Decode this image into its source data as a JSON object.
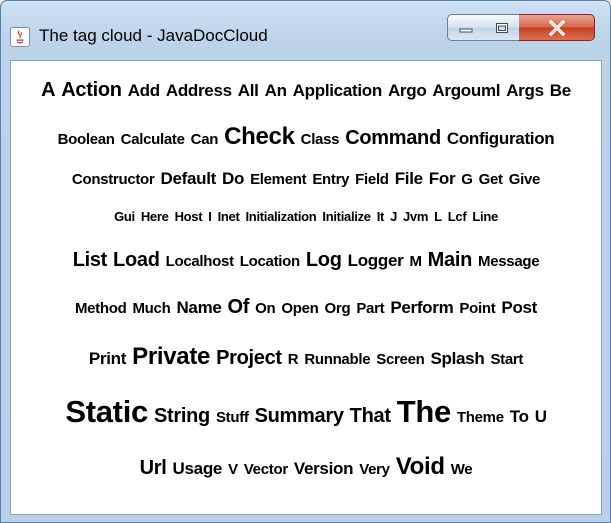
{
  "window": {
    "title": "The tag cloud - JavaDocCloud",
    "controls": {
      "minimize": "minimize",
      "maximize": "maximize",
      "close": "close"
    }
  },
  "tag_cloud": {
    "rows": [
      [
        {
          "text": "A",
          "size": 4
        },
        {
          "text": "Action",
          "size": 4
        },
        {
          "text": "Add",
          "size": 3
        },
        {
          "text": "Address",
          "size": 3
        },
        {
          "text": "All",
          "size": 3
        },
        {
          "text": "An",
          "size": 3
        },
        {
          "text": "Application",
          "size": 3
        },
        {
          "text": "Argo",
          "size": 3
        },
        {
          "text": "Argouml",
          "size": 3
        },
        {
          "text": "Args",
          "size": 3
        },
        {
          "text": "Be",
          "size": 3
        }
      ],
      [
        {
          "text": "Boolean",
          "size": 2
        },
        {
          "text": "Calculate",
          "size": 2
        },
        {
          "text": "Can",
          "size": 2
        },
        {
          "text": "Check",
          "size": 5
        },
        {
          "text": "Class",
          "size": 2
        },
        {
          "text": "Command",
          "size": 4
        },
        {
          "text": "Configuration",
          "size": 3
        }
      ],
      [
        {
          "text": "Constructor",
          "size": 2
        },
        {
          "text": "Default",
          "size": 3
        },
        {
          "text": "Do",
          "size": 3
        },
        {
          "text": "Element",
          "size": 2
        },
        {
          "text": "Entry",
          "size": 2
        },
        {
          "text": "Field",
          "size": 2
        },
        {
          "text": "File",
          "size": 3
        },
        {
          "text": "For",
          "size": 3
        },
        {
          "text": "G",
          "size": 2
        },
        {
          "text": "Get",
          "size": 2
        },
        {
          "text": "Give",
          "size": 2
        }
      ],
      [
        {
          "text": "Gui",
          "size": 1
        },
        {
          "text": "Here",
          "size": 1
        },
        {
          "text": "Host",
          "size": 1
        },
        {
          "text": "I",
          "size": 1
        },
        {
          "text": "Inet",
          "size": 1
        },
        {
          "text": "Initialization",
          "size": 1
        },
        {
          "text": "Initialize",
          "size": 1
        },
        {
          "text": "It",
          "size": 1
        },
        {
          "text": "J",
          "size": 1
        },
        {
          "text": "Jvm",
          "size": 1
        },
        {
          "text": "L",
          "size": 1
        },
        {
          "text": "Lcf",
          "size": 1
        },
        {
          "text": "Line",
          "size": 1
        }
      ],
      [
        {
          "text": "List",
          "size": 4
        },
        {
          "text": "Load",
          "size": 4
        },
        {
          "text": "Localhost",
          "size": 2
        },
        {
          "text": "Location",
          "size": 2
        },
        {
          "text": "Log",
          "size": 4
        },
        {
          "text": "Logger",
          "size": 3
        },
        {
          "text": "M",
          "size": 2
        },
        {
          "text": "Main",
          "size": 4
        },
        {
          "text": "Message",
          "size": 2
        }
      ],
      [
        {
          "text": "Method",
          "size": 2
        },
        {
          "text": "Much",
          "size": 2
        },
        {
          "text": "Name",
          "size": 3
        },
        {
          "text": "Of",
          "size": 4
        },
        {
          "text": "On",
          "size": 2
        },
        {
          "text": "Open",
          "size": 2
        },
        {
          "text": "Org",
          "size": 2
        },
        {
          "text": "Part",
          "size": 2
        },
        {
          "text": "Perform",
          "size": 3
        },
        {
          "text": "Point",
          "size": 2
        },
        {
          "text": "Post",
          "size": 3
        }
      ],
      [
        {
          "text": "Print",
          "size": 3
        },
        {
          "text": "Private",
          "size": 5
        },
        {
          "text": "Project",
          "size": 4
        },
        {
          "text": "R",
          "size": 2
        },
        {
          "text": "Runnable",
          "size": 2
        },
        {
          "text": "Screen",
          "size": 2
        },
        {
          "text": "Splash",
          "size": 3
        },
        {
          "text": "Start",
          "size": 2
        }
      ],
      [
        {
          "text": "Static",
          "size": 6
        },
        {
          "text": "String",
          "size": 4
        },
        {
          "text": "Stuff",
          "size": 2
        },
        {
          "text": "Summary",
          "size": 4
        },
        {
          "text": "That",
          "size": 4
        },
        {
          "text": "The",
          "size": 6
        },
        {
          "text": "Theme",
          "size": 2
        },
        {
          "text": "To",
          "size": 3
        },
        {
          "text": "U",
          "size": 3
        }
      ],
      [
        {
          "text": "Url",
          "size": 4
        },
        {
          "text": "Usage",
          "size": 3
        },
        {
          "text": "V",
          "size": 2
        },
        {
          "text": "Vector",
          "size": 2
        },
        {
          "text": "Version",
          "size": 3
        },
        {
          "text": "Very",
          "size": 2
        },
        {
          "text": "Void",
          "size": 5
        },
        {
          "text": "We",
          "size": 2
        }
      ]
    ]
  }
}
